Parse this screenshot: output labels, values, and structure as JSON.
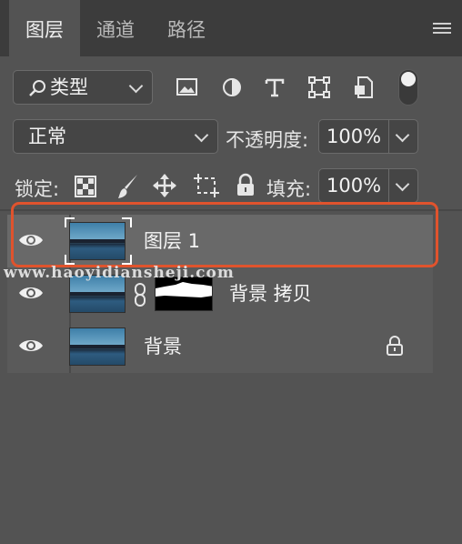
{
  "tabs": [
    {
      "label": "图层"
    },
    {
      "label": "通道"
    },
    {
      "label": "路径"
    }
  ],
  "filter": {
    "label": "类型"
  },
  "blend": {
    "mode": "正常",
    "opacity_label": "不透明度:",
    "opacity_value": "100%"
  },
  "lock": {
    "label": "锁定:",
    "fill_label": "填充:",
    "fill_value": "100%"
  },
  "layers": [
    {
      "name": "图层 1",
      "selected": true
    },
    {
      "name": "背景 拷贝",
      "has_mask": true
    },
    {
      "name": "背景",
      "locked": true
    }
  ],
  "watermark": "www.haoyidianshejі.com",
  "colors": {
    "panel": "#535353",
    "tabbar": "#3c3c3c",
    "selection_outline": "#e0532d"
  }
}
